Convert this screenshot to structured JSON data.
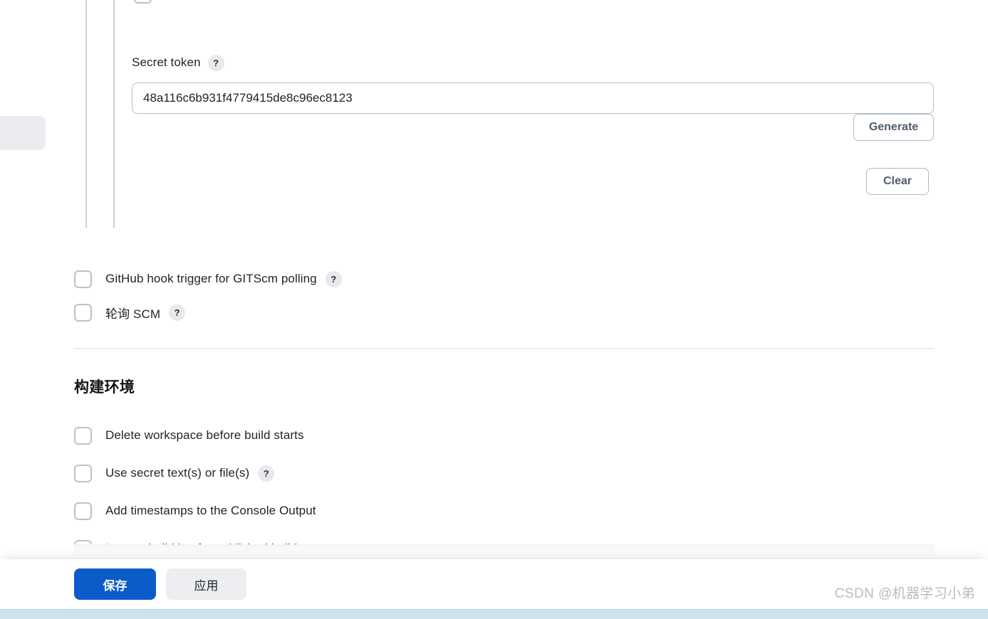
{
  "colors": {
    "primary_button": "#0b5cc8",
    "secondary_button": "#eceef1",
    "checkbox_border": "#b8c2cc",
    "outline_button_border": "#aebac6",
    "guide_line": "#c5ced6",
    "divider": "#eceef0",
    "bottom_band": "#cfe3ef",
    "sidebar_pill": "#ebecf0"
  },
  "secret_token": {
    "label": "Secret token",
    "help_icon": "?",
    "value": "48a116c6b931f4779415de8c96ec8123",
    "placeholder": "",
    "generate_label": "Generate",
    "clear_label": "Clear"
  },
  "triggers": {
    "items": [
      {
        "label": "GitHub hook trigger for GITScm polling",
        "checked": false,
        "help": "?"
      },
      {
        "label": "轮询 SCM",
        "checked": false,
        "help": "?"
      }
    ]
  },
  "build_environment": {
    "heading": "构建环境",
    "items": [
      {
        "label": "Delete workspace before build starts",
        "checked": false,
        "help": ""
      },
      {
        "label": "Use secret text(s) or file(s)",
        "checked": false,
        "help": "?"
      },
      {
        "label": "Add timestamps to the Console Output",
        "checked": false,
        "help": ""
      },
      {
        "label": "Inspect build log for published build scans",
        "checked": false,
        "help": ""
      }
    ]
  },
  "footer": {
    "save_label": "保存",
    "apply_label": "应用"
  },
  "watermark": {
    "text": "CSDN @机器学习小弟"
  }
}
